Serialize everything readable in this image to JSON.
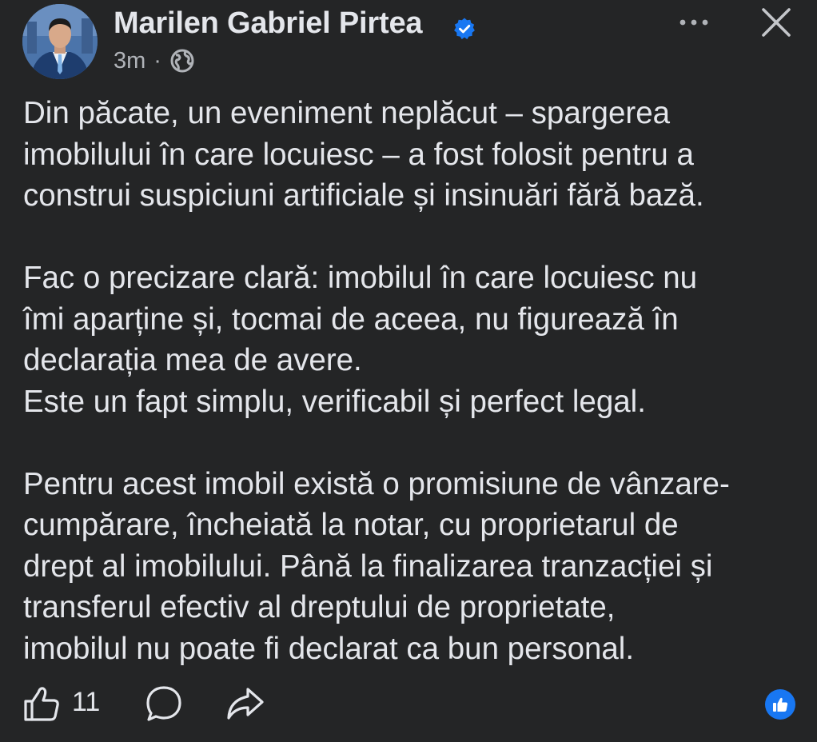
{
  "post": {
    "author": {
      "name": "Marilen Gabriel Pirtea",
      "verified": true
    },
    "time": "3m",
    "separator": "·",
    "audience_icon": "globe-icon",
    "header_actions": {
      "more_icon": "more-horizontal-icon",
      "close_icon": "close-icon"
    },
    "body": {
      "paragraph_1": [
        "Din păcate, un eveniment neplăcut – spargerea",
        "imobilului în care locuiesc – a fost folosit pentru a",
        "construi suspiciuni artificiale și insinuări fără bază."
      ],
      "paragraph_2": [
        "Fac o precizare clară: imobilul în care locuiesc nu",
        "îmi aparține și, tocmai de aceea, nu figurează în",
        "declarația mea de avere.",
        "Este un fapt simplu, verificabil și perfect legal."
      ],
      "paragraph_3": [
        "Pentru acest imobil există o promisiune de vânzare-",
        "cumpărare, încheiată la notar, cu proprietarul de",
        "drept al imobilului. Până la finalizarea tranzacției și",
        "transferul efectiv al dreptului de proprietate,",
        "imobilul nu poate fi declarat ca bun personal."
      ]
    },
    "actions": {
      "like_icon": "thumbs-up-icon",
      "like_count": "11",
      "comment_icon": "comment-icon",
      "share_icon": "share-icon",
      "reaction_icon": "like-reaction-icon"
    },
    "colors": {
      "background": "#242526",
      "text": "#e4e6eb",
      "secondary_text": "#b0b3b8",
      "accent": "#1877f2"
    }
  }
}
